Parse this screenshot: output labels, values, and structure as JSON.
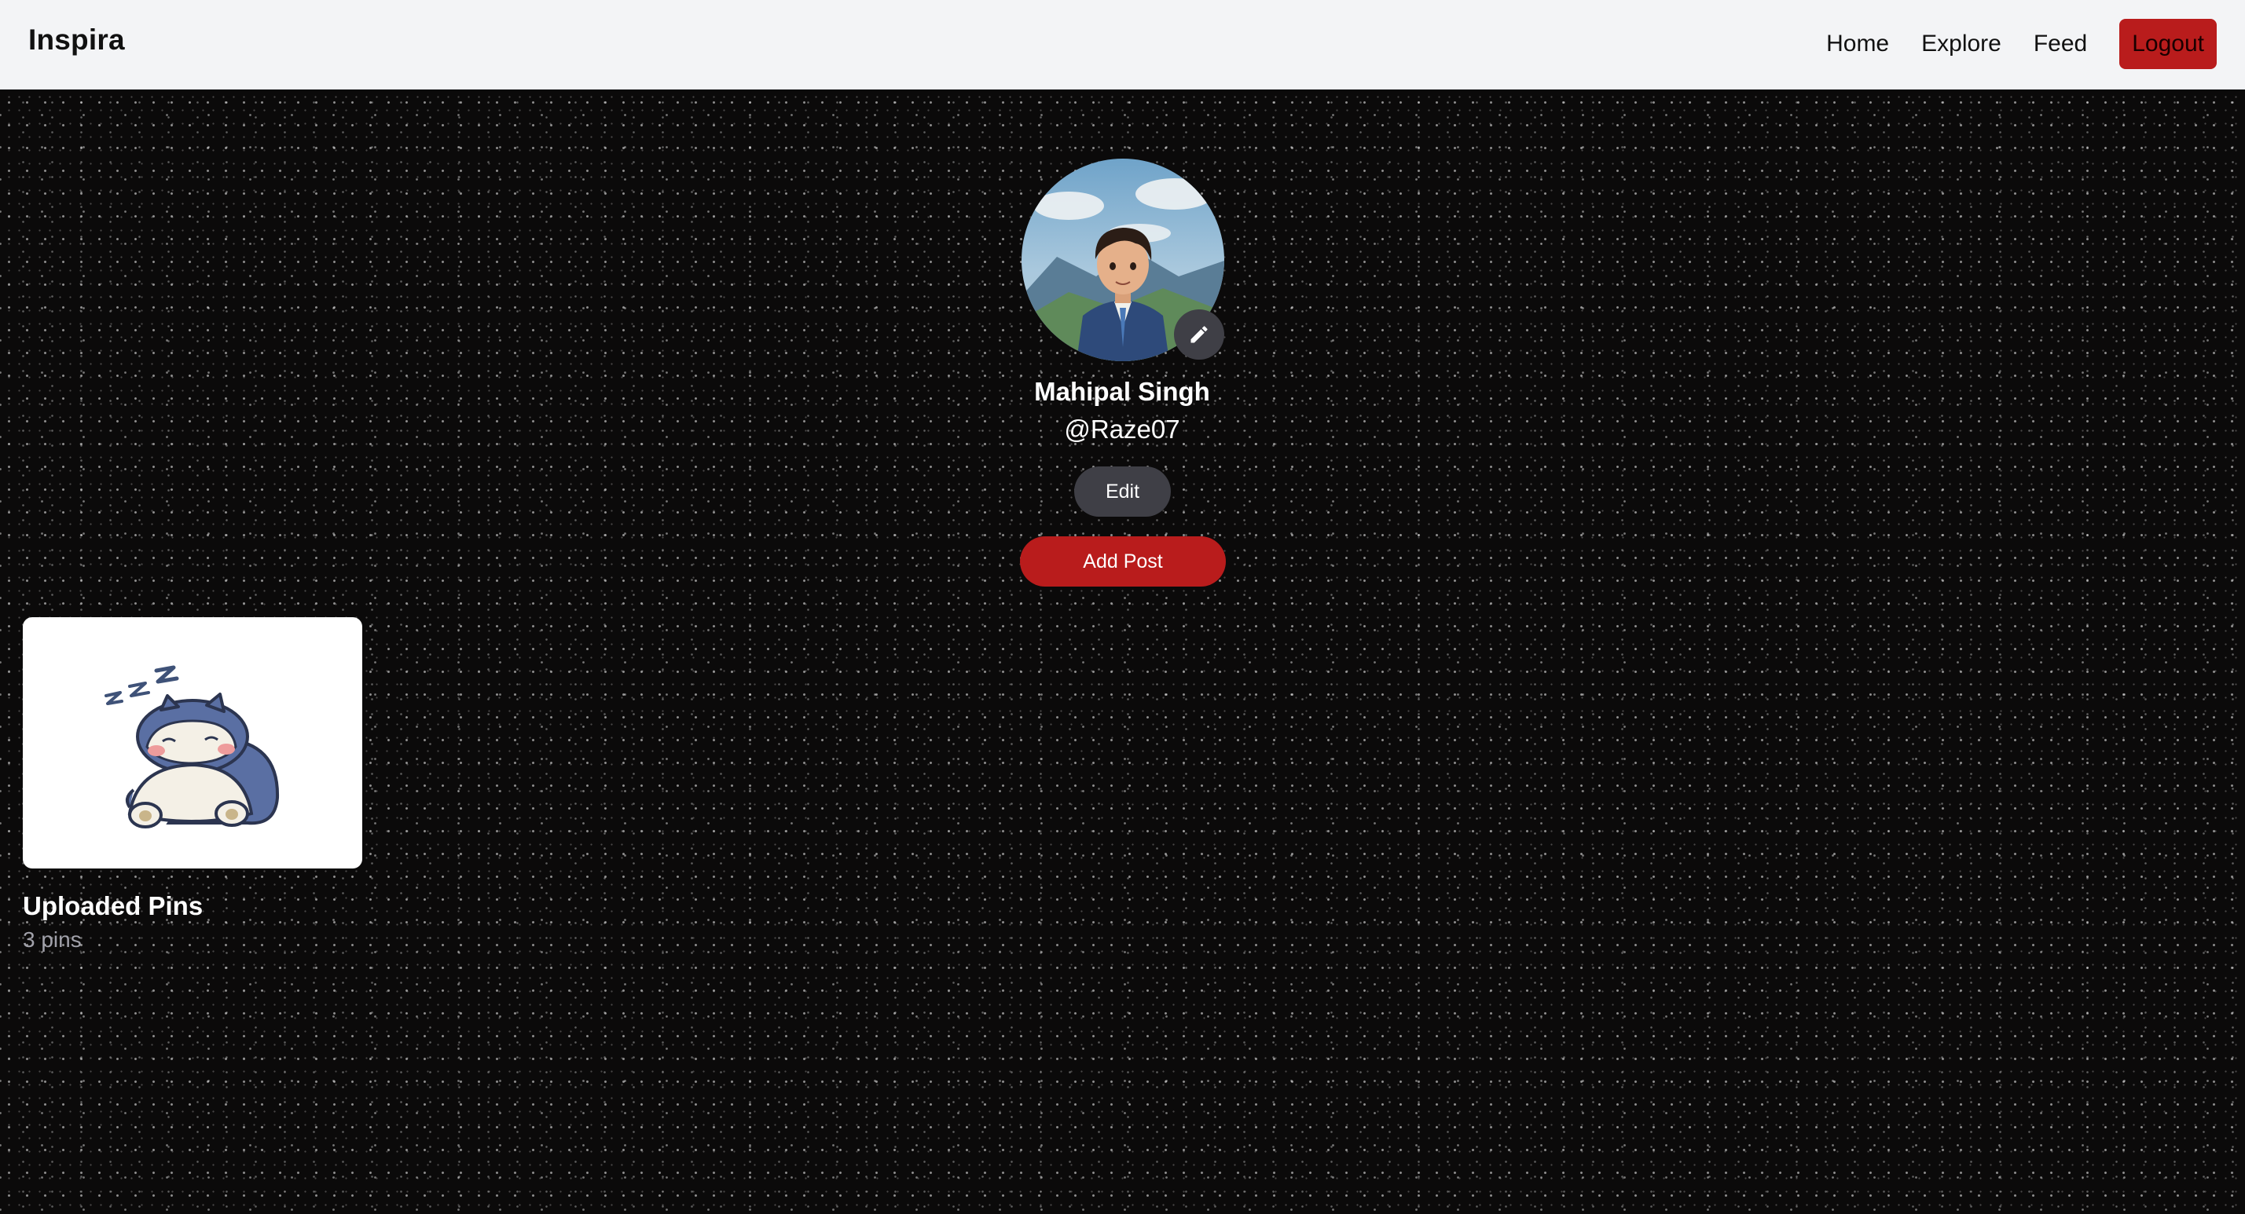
{
  "navbar": {
    "brand": "Inspira",
    "links": [
      "Home",
      "Explore",
      "Feed"
    ],
    "logout_label": "Logout"
  },
  "profile": {
    "name": "Mahipal Singh",
    "username": "@Raze07",
    "edit_label": "Edit",
    "add_post_label": "Add Post",
    "avatar_icon": "edit-pencil-icon"
  },
  "boards": [
    {
      "title": "Uploaded Pins",
      "count_label": "3 pins"
    }
  ],
  "colors": {
    "accent": "#b91c1c",
    "navbar_bg": "#f3f4f6",
    "page_bg": "#0b0a0a",
    "button_dark": "#3f3f46"
  }
}
